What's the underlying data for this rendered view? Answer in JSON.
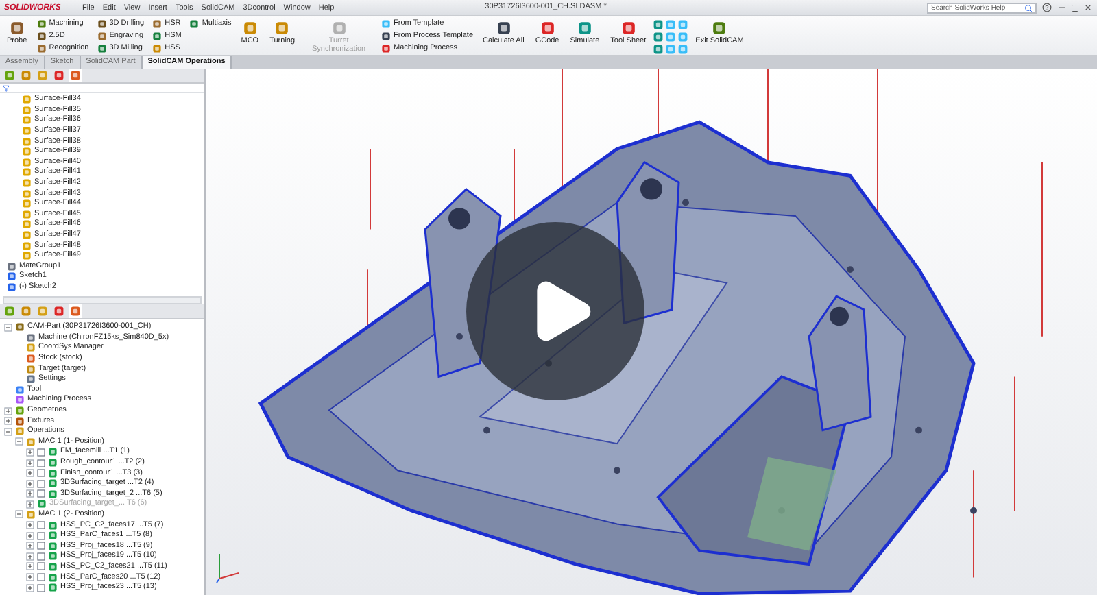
{
  "app": {
    "logo": "SOLIDWORKS",
    "menus": [
      "File",
      "Edit",
      "View",
      "Insert",
      "Tools",
      "SolidCAM",
      "3Dcontrol",
      "Window",
      "Help"
    ],
    "document_title": "30P31726I3600-001_CH.SLDASM *",
    "search": {
      "placeholder": "Search SolidWorks Help"
    }
  },
  "ribbon": [
    {
      "kind": "large",
      "label": "Probe",
      "disabled": false
    },
    {
      "kind": "stack",
      "items": [
        "Machining",
        "2.5D",
        "Recognition"
      ]
    },
    {
      "kind": "stack",
      "items": [
        "3D Drilling",
        "Engraving",
        "3D Milling"
      ]
    },
    {
      "kind": "stack",
      "items": [
        "HSR",
        "HSM",
        "HSS"
      ]
    },
    {
      "kind": "stack",
      "items": [
        "Multiaxis"
      ]
    },
    {
      "kind": "large",
      "label": "MCO",
      "disabled": false
    },
    {
      "kind": "large",
      "label": "Turning",
      "disabled": false
    },
    {
      "kind": "large",
      "label": "Turret Synchronization",
      "disabled": true
    },
    {
      "kind": "stack",
      "items": [
        "From Template",
        "From Process Template",
        "Machining Process"
      ]
    },
    {
      "kind": "large",
      "label": "Calculate All",
      "disabled": false
    },
    {
      "kind": "large",
      "label": "GCode",
      "disabled": false
    },
    {
      "kind": "large",
      "label": "Simulate",
      "disabled": false
    },
    {
      "kind": "large",
      "label": "Tool Sheet",
      "disabled": false
    },
    {
      "kind": "grid"
    },
    {
      "kind": "large",
      "label": "Exit SolidCAM",
      "disabled": false
    }
  ],
  "tabs": [
    {
      "label": "Assembly",
      "selected": false
    },
    {
      "label": "Sketch",
      "selected": false
    },
    {
      "label": "SolidCAM Part",
      "selected": false
    },
    {
      "label": "SolidCAM Operations",
      "selected": true
    }
  ],
  "feature_tree": [
    {
      "label": "Surface-Fill34",
      "kind": "surface"
    },
    {
      "label": "Surface-Fill35",
      "kind": "surface"
    },
    {
      "label": "Surface-Fill36",
      "kind": "surface"
    },
    {
      "label": "Surface-Fill37",
      "kind": "surface"
    },
    {
      "label": "Surface-Fill38",
      "kind": "surface"
    },
    {
      "label": "Surface-Fill39",
      "kind": "surface"
    },
    {
      "label": "Surface-Fill40",
      "kind": "surface"
    },
    {
      "label": "Surface-Fill41",
      "kind": "surface"
    },
    {
      "label": "Surface-Fill42",
      "kind": "surface"
    },
    {
      "label": "Surface-Fill43",
      "kind": "surface"
    },
    {
      "label": "Surface-Fill44",
      "kind": "surface"
    },
    {
      "label": "Surface-Fill45",
      "kind": "surface"
    },
    {
      "label": "Surface-Fill46",
      "kind": "surface"
    },
    {
      "label": "Surface-Fill47",
      "kind": "surface"
    },
    {
      "label": "Surface-Fill48",
      "kind": "surface"
    },
    {
      "label": "Surface-Fill49",
      "kind": "surface"
    },
    {
      "label": "MateGroup1",
      "kind": "mate"
    },
    {
      "label": "Sketch1",
      "kind": "sketch"
    },
    {
      "label": "(-) Sketch2",
      "kind": "sketch"
    }
  ],
  "cam_tree": [
    {
      "label": "CAM-Part (30P31726I3600-001_CH)",
      "kind": "part",
      "expanded": true,
      "children": [
        {
          "label": "Machine (ChironFZ15ks_Sim840D_5x)",
          "kind": "machine"
        },
        {
          "label": "CoordSys Manager",
          "kind": "coordsys"
        },
        {
          "label": "Stock (stock)",
          "kind": "stock"
        },
        {
          "label": "Target (target)",
          "kind": "target"
        },
        {
          "label": "Settings",
          "kind": "settings"
        }
      ]
    },
    {
      "label": "Tool",
      "kind": "tool"
    },
    {
      "label": "Machining Process",
      "kind": "process"
    },
    {
      "label": "Geometries",
      "kind": "geometry",
      "expanded": false
    },
    {
      "label": "Fixtures",
      "kind": "fixture",
      "expanded": false
    },
    {
      "label": "Operations",
      "kind": "folder",
      "expanded": true,
      "children": [
        {
          "label": "MAC 1 (1- Position)",
          "kind": "mac",
          "expanded": true,
          "children": [
            {
              "label": "FM_facemill ...T1 (1)",
              "kind": "operation",
              "expanded": false,
              "checked": false
            },
            {
              "label": "Rough_contour1 ...T2 (2)",
              "kind": "operation",
              "expanded": false,
              "checked": false
            },
            {
              "label": "Finish_contour1 ...T3 (3)",
              "kind": "operation",
              "expanded": false,
              "checked": false
            },
            {
              "label": "3DSurfacing_target ...T2 (4)",
              "kind": "operation",
              "expanded": false,
              "checked": false
            },
            {
              "label": "3DSurfacing_target_2 ...T6 (5)",
              "kind": "operation",
              "expanded": false,
              "checked": false
            },
            {
              "label": "3DSurfacing_target_... T6 (6)",
              "kind": "operation",
              "expanded": false,
              "disabled": true
            }
          ]
        },
        {
          "label": "MAC 1 (2- Position)",
          "kind": "mac",
          "expanded": true,
          "children": [
            {
              "label": "HSS_PC_C2_faces17 ...T5 (7)",
              "kind": "operation",
              "expanded": false,
              "checked": false
            },
            {
              "label": "HSS_ParC_faces1 ...T5 (8)",
              "kind": "operation",
              "expanded": false,
              "checked": false
            },
            {
              "label": "HSS_Proj_faces18 ...T5 (9)",
              "kind": "operation",
              "expanded": false,
              "checked": false
            },
            {
              "label": "HSS_Proj_faces19 ...T5 (10)",
              "kind": "operation",
              "expanded": false,
              "checked": false
            },
            {
              "label": "HSS_PC_C2_faces21 ...T5 (11)",
              "kind": "operation",
              "expanded": false,
              "checked": false
            },
            {
              "label": "HSS_ParC_faces20 ...T5 (12)",
              "kind": "operation",
              "expanded": false,
              "checked": false
            },
            {
              "label": "HSS_Proj_faces23 ...T5 (13)",
              "kind": "operation",
              "expanded": false,
              "checked": false
            }
          ]
        }
      ]
    }
  ]
}
